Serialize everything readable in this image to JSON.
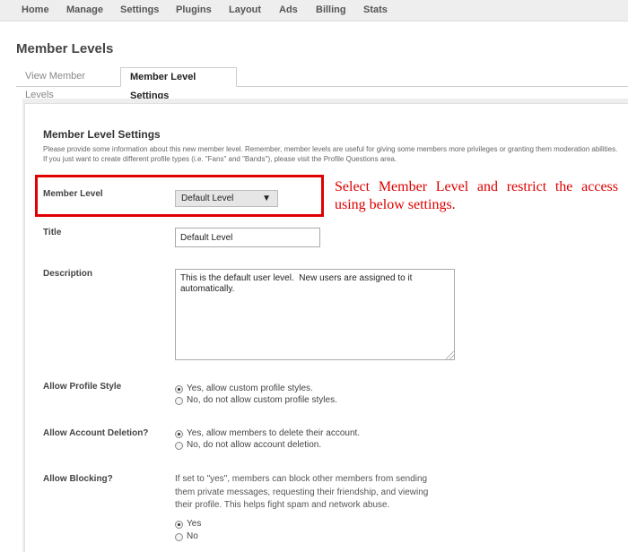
{
  "nav": {
    "items": [
      "Home",
      "Manage",
      "Settings",
      "Plugins",
      "Layout",
      "Ads",
      "Billing",
      "Stats"
    ]
  },
  "page_title": "Member Levels",
  "tabs": [
    {
      "label": "View Member Levels",
      "active": false
    },
    {
      "label": "Member Level Settings",
      "active": true
    }
  ],
  "section": {
    "title": "Member Level Settings",
    "description": "Please provide some information about this new member level. Remember, member levels are useful for giving some members more privileges or granting them moderation abilities. If you just want to create different profile types (i.e. \"Fans\" and \"Bands\"), please visit the Profile Questions area."
  },
  "fields": {
    "member_level": {
      "label": "Member Level",
      "value": "Default Level"
    },
    "title": {
      "label": "Title",
      "value": "Default Level"
    },
    "description": {
      "label": "Description",
      "value": "This is the default user level.  New users are assigned to it automatically."
    },
    "allow_profile_style": {
      "label": "Allow Profile Style",
      "options": [
        "Yes, allow custom profile styles.",
        "No, do not allow custom profile styles."
      ],
      "selected": 0
    },
    "allow_account_deletion": {
      "label": "Allow Account Deletion?",
      "options": [
        "Yes, allow members to delete their account.",
        "No, do not allow account deletion."
      ],
      "selected": 0
    },
    "allow_blocking": {
      "label": "Allow Blocking?",
      "help": "If set to \"yes\", members can block other members from sending them private messages, requesting their friendship, and viewing their profile. This helps fight spam and network abuse.",
      "options": [
        "Yes",
        "No"
      ],
      "selected": 0
    }
  },
  "annotation": {
    "text": "Select Member Level and restrict the access using below settings.",
    "color": "#dd0000"
  }
}
